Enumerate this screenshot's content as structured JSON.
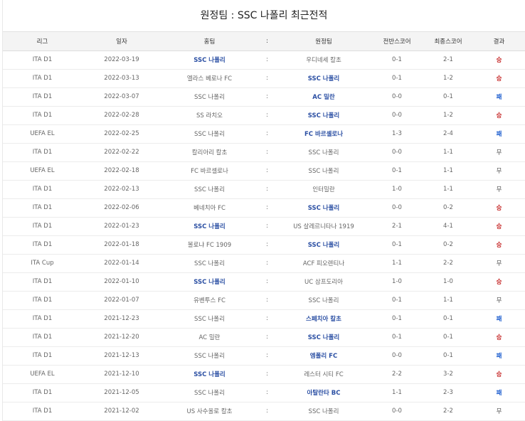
{
  "page": {
    "title": "원정팀 : SSC 나폴리 최근전적"
  },
  "table": {
    "headers": [
      "리그",
      "일자",
      "홈팀",
      ":",
      "원정팀",
      "전반스코어",
      "최종스코어",
      "결과"
    ],
    "rows": [
      {
        "league": "ITA D1",
        "date": "2022-03-19",
        "home": "SSC 나폴리",
        "sep": ":",
        "away": "우디네세 칼초",
        "half": "0-1",
        "final": "2-1",
        "result": "승",
        "bold": "home",
        "rtype": "win"
      },
      {
        "league": "ITA D1",
        "date": "2022-03-13",
        "home": "엘라스 베로나 FC",
        "sep": ":",
        "away": "SSC 나폴리",
        "half": "0-1",
        "final": "1-2",
        "result": "승",
        "bold": "away",
        "rtype": "win"
      },
      {
        "league": "ITA D1",
        "date": "2022-03-07",
        "home": "SSC 나폴리",
        "sep": ":",
        "away": "AC 밀란",
        "half": "0-0",
        "final": "0-1",
        "result": "패",
        "bold": "away",
        "rtype": "loss"
      },
      {
        "league": "ITA D1",
        "date": "2022-02-28",
        "home": "SS 라치오",
        "sep": ":",
        "away": "SSC 나폴리",
        "half": "0-0",
        "final": "1-2",
        "result": "승",
        "bold": "away",
        "rtype": "win"
      },
      {
        "league": "UEFA EL",
        "date": "2022-02-25",
        "home": "SSC 나폴리",
        "sep": ":",
        "away": "FC 바르셀로나",
        "half": "1-3",
        "final": "2-4",
        "result": "패",
        "bold": "away",
        "rtype": "loss"
      },
      {
        "league": "ITA D1",
        "date": "2022-02-22",
        "home": "칼리아리 칼초",
        "sep": ":",
        "away": "SSC 나폴리",
        "half": "0-0",
        "final": "1-1",
        "result": "무",
        "bold": "",
        "rtype": "draw"
      },
      {
        "league": "UEFA EL",
        "date": "2022-02-18",
        "home": "FC 바르셀로나",
        "sep": ":",
        "away": "SSC 나폴리",
        "half": "0-1",
        "final": "1-1",
        "result": "무",
        "bold": "",
        "rtype": "draw"
      },
      {
        "league": "ITA D1",
        "date": "2022-02-13",
        "home": "SSC 나폴리",
        "sep": ":",
        "away": "인터밀란",
        "half": "1-0",
        "final": "1-1",
        "result": "무",
        "bold": "",
        "rtype": "draw"
      },
      {
        "league": "ITA D1",
        "date": "2022-02-06",
        "home": "베네치아 FC",
        "sep": ":",
        "away": "SSC 나폴리",
        "half": "0-0",
        "final": "0-2",
        "result": "승",
        "bold": "away",
        "rtype": "win"
      },
      {
        "league": "ITA D1",
        "date": "2022-01-23",
        "home": "SSC 나폴리",
        "sep": ":",
        "away": "US 살레르니타나 1919",
        "half": "2-1",
        "final": "4-1",
        "result": "승",
        "bold": "home",
        "rtype": "win"
      },
      {
        "league": "ITA D1",
        "date": "2022-01-18",
        "home": "볼로냐 FC 1909",
        "sep": ":",
        "away": "SSC 나폴리",
        "half": "0-1",
        "final": "0-2",
        "result": "승",
        "bold": "away",
        "rtype": "win"
      },
      {
        "league": "ITA Cup",
        "date": "2022-01-14",
        "home": "SSC 나폴리",
        "sep": ":",
        "away": "ACF 피오렌티나",
        "half": "1-1",
        "final": "2-2",
        "result": "무",
        "bold": "",
        "rtype": "draw"
      },
      {
        "league": "ITA D1",
        "date": "2022-01-10",
        "home": "SSC 나폴리",
        "sep": ":",
        "away": "UC 삼프도리아",
        "half": "1-0",
        "final": "1-0",
        "result": "승",
        "bold": "home",
        "rtype": "win"
      },
      {
        "league": "ITA D1",
        "date": "2022-01-07",
        "home": "유벤투스 FC",
        "sep": ":",
        "away": "SSC 나폴리",
        "half": "0-1",
        "final": "1-1",
        "result": "무",
        "bold": "",
        "rtype": "draw"
      },
      {
        "league": "ITA D1",
        "date": "2021-12-23",
        "home": "SSC 나폴리",
        "sep": ":",
        "away": "스페치아 칼초",
        "half": "0-1",
        "final": "0-1",
        "result": "패",
        "bold": "away",
        "rtype": "loss"
      },
      {
        "league": "ITA D1",
        "date": "2021-12-20",
        "home": "AC 밀란",
        "sep": ":",
        "away": "SSC 나폴리",
        "half": "0-1",
        "final": "0-1",
        "result": "승",
        "bold": "away",
        "rtype": "win"
      },
      {
        "league": "ITA D1",
        "date": "2021-12-13",
        "home": "SSC 나폴리",
        "sep": ":",
        "away": "엠폴리 FC",
        "half": "0-0",
        "final": "0-1",
        "result": "패",
        "bold": "away",
        "rtype": "loss"
      },
      {
        "league": "UEFA EL",
        "date": "2021-12-10",
        "home": "SSC 나폴리",
        "sep": ":",
        "away": "레스터 시티 FC",
        "half": "2-2",
        "final": "3-2",
        "result": "승",
        "bold": "home",
        "rtype": "win"
      },
      {
        "league": "ITA D1",
        "date": "2021-12-05",
        "home": "SSC 나폴리",
        "sep": ":",
        "away": "아탈란타 BC",
        "half": "1-1",
        "final": "2-3",
        "result": "패",
        "bold": "away",
        "rtype": "loss"
      },
      {
        "league": "ITA D1",
        "date": "2021-12-02",
        "home": "US 사수올로 칼초",
        "sep": ":",
        "away": "SSC 나폴리",
        "half": "0-0",
        "final": "2-2",
        "result": "무",
        "bold": "",
        "rtype": "draw"
      }
    ]
  },
  "colors": {
    "win": "#c62828",
    "loss": "#1f5fcf",
    "team_highlight": "#2b4fa3"
  }
}
